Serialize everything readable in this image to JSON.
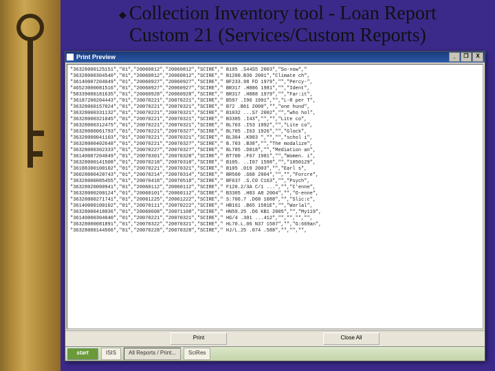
{
  "title_line1": "Collection Inventory tool - Loan Report",
  "title_line2": "Custom 21 (Services/Custom Reports)",
  "window": {
    "title": "Print Preview",
    "min": "_",
    "max": "❐",
    "close": "X"
  },
  "buttons": {
    "print": "Print",
    "close": "Close All"
  },
  "taskbar": {
    "start": "start",
    "items": [
      "ISIS",
      "All Reports / Print...",
      "SciRes"
    ]
  },
  "report_rows": [
    "\"36328000125151\",\"01\",\"20060812\",\"20060812\",\"SCIRE\",\" B105 .S44S5 2003\",\"So-now\",\"",
    "\"36328000304540\",\"01\",\"20060812\",\"20060812\",\"SCIRE\",\" B1200.B36 2001\",\"Climate ch\",",
    "\"36140007204049\",\"01\",\"20060927\",\"20060927\",\"SCIRE\",\" BF233.98 FD 1979\",\"\",\"Percy-\",",
    "\"46523000081516\",\"01\",\"20060927\",\"20060927\",\"SCIRE\",\" BR317 .H886 1981\",\"\",\"Ident\",",
    "\"58339000181635\",\"01\",\"20060928\",\"20060928\",\"SCIRE\",\" BR317 .H888 1979\",\"\",\"Far:it\",",
    "\"36187200204443\",\"01\",\"20070221\",\"20070221\",\"SCIRE\",\" B597 .I96 1991\",\"\",\"L-R per T\",",
    "\"36328060157024\",\"01\",\"20070221\",\"20070321\",\"SCIRE\",\" B72 .B61 2000\",\"\",\"one hund\",",
    "\"36328000331132\",\"01\",\"20070221\",\"20070321\",\"SCIRE\",\" B1032 ...S7 2002\",\"\",\"who hol\",",
    "\"36328000321045\",\"01\",\"20070221\",\"20070321\",\"SCIRE\",\" B3305 .I43\",\"\",\"\",\"Lite co\",",
    "\"36328000312475\",\"01\",\"20070221\",\"20070321\",\"SCIRE\",\" BL703 .I53 1992\",\"\",\"Lite co\",",
    "\"36328000061793\",\"01\",\"20070221\",\"20070327\",\"SCIRE\",\" BL705 .I63 1926\",\"\",\"Glock\",",
    "\"36328000041103\",\"01\",\"20070221\",\"20070321\",\"SCIRE\",\" BL304 .K983 \",\"\",\"\",\"schol i\",",
    "\"36328000402648\",\"01\",\"20070221\",\"20070327\",\"SCIRE\",\" B.703 .B38\",\"\",\"The modalize\",",
    "\"36328000302333\",\"01\",\"20070227\",\"20070327\",\"SCIRE\",\" BL785 .D818\",\"\",\"Mediation an\",",
    "\"36140007204049\",\"01\",\"20070301\",\"20070328\",\"SCIRE\",\" BT700 .F67 1981\",\"\",\"Women. i\",",
    "\"36328000141508\",\"01\",\"20070218\",\"20070318\",\"SCIRE\",\" B105. ..I07 1598\",\"\",\"1050129\",",
    "\"36188300100102\",\"01\",\"20070221\",\"20070321\",\"SCIRE\",\" B105 .019 2003\",\"\",\"Earl s\",",
    "\"36028000420743\",\"01\",\"20070214\",\"20070314\",\"SCIRE\",\" BR560 .G68 2004\",\"\",\"\",\"Forcre\",",
    "\"36328000085455\",\"01\",\"20070418\",\"20070518\",\"SCIRE\",\" BF637 .S.C0 C163\",\"\",\"Psych\",",
    "\"36328020000941\",\"01\",\"20060112\",\"20060112\",\"SCIRE\",\" F120.2/3A C/1 ...\",\"\",\"C'enne\",",
    "\"36328000200124\",\"01\",\"20060101\",\"20060112\",\"SCIRE\",\" B3305 .H83 A8 2004\",\"\",\"O-enne\",",
    "\"36328000271741\",\"01\",\"20061225\",\"20061222\",\"SCIRE\",\" S:706.7 .D68 1088\",\"\",\"Slic:c\",",
    "\"36140000100102\",\"01\",\"20070111\",\"20070222\",\"SCIRE\",\" HB161 .B65 1581E\",\"\",\"Worlal\",",
    "\"36328000418036\",\"01\",\"20060608\",\"20071108\",\"SCIRE\",\" HN59.25 .D6 KB1 2005\",\"\",\"My119\",",
    "\"36140000304040\",\"01\",\"20070221\",\"20070321\",\"SCIRE\",\" HG/4 .301 ...412\",\"\",\"\",\"\",\"\",",
    "\"36328000081891\",\"01\",\"20070322\",\"20070321\",\"SCIRE\",\" HL70.L.06 N37 1587\",\"\",\"G:669an\",",
    "\"36328000144566\",\"01\",\"20070228\",\"20070328\",\"SCIRE\",\" HJ/L.25 .074 .588\",\"\",\"\",\"\","
  ]
}
